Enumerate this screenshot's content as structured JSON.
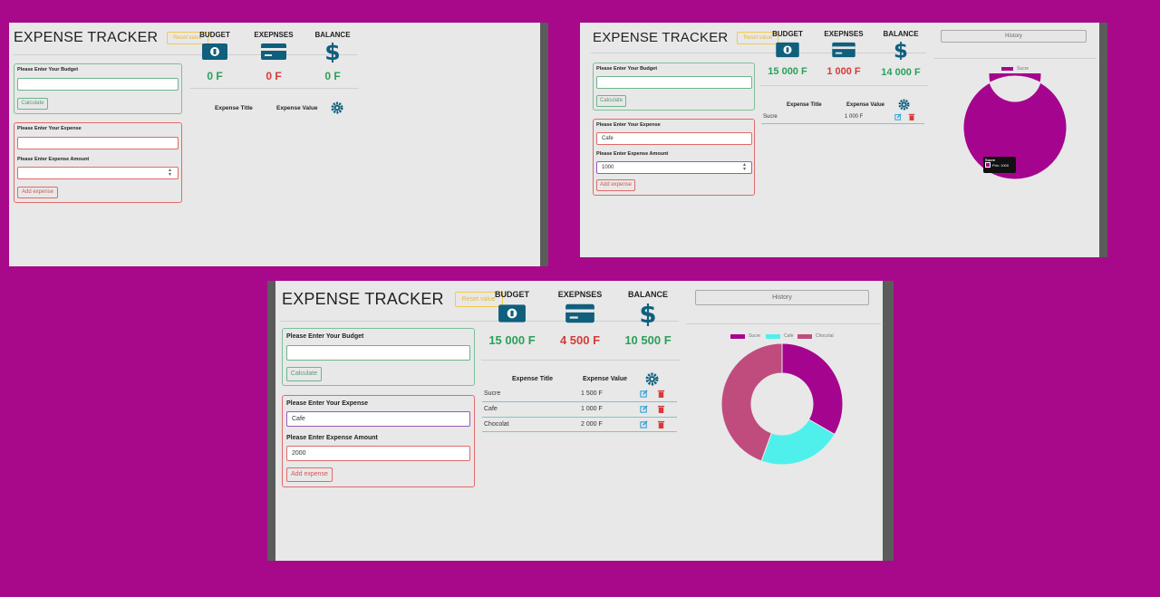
{
  "app": {
    "title": "EXPENSE TRACKER",
    "reset_label": "Reset value",
    "budget_label": "BUDGET",
    "expenses_label": "EXEPNSES",
    "balance_label": "BALANCE",
    "budget_input_label": "Please Enter Your Budget",
    "calculate_label": "Calculate",
    "expense_input_label": "Please Enter Your Expense",
    "amount_input_label": "Please Enter Expense Amount",
    "add_expense_label": "Add expense",
    "col_title": "Expense Title",
    "col_value": "Expense Value",
    "history_label": "History"
  },
  "colors": {
    "page_bg": "#a8098a",
    "panel_bg": "#e8e8e8",
    "icon_blue": "#0f5f7d",
    "green": "#2aa05a",
    "red": "#d63a3a",
    "sucre": "#a5058e",
    "cafe": "#4ff0ec",
    "chocolat": "#c04c7d"
  },
  "icons": [
    "money-bill-icon",
    "credit-card-icon",
    "dollar-icon",
    "gear-icon",
    "edit-icon",
    "trash-icon"
  ],
  "shot1": {
    "budget": "0 F",
    "expenses": "0 F",
    "balance": "0 F",
    "budget_input": "",
    "expense_input": "",
    "amount_input": ""
  },
  "shot2": {
    "budget": "15 000 F",
    "expenses": "1 000 F",
    "balance": "14 000 F",
    "budget_input": "",
    "expense_input": "Cafe",
    "amount_input": "1000",
    "rows": [
      {
        "title": "Sucre",
        "value": "1 000 F"
      }
    ],
    "legend": [
      {
        "name": "Sucre"
      }
    ],
    "tooltip": {
      "title": "Sucre",
      "body": "Prix: 1000"
    },
    "chart_data": {
      "type": "pie",
      "categories": [
        "Sucre"
      ],
      "values": [
        1000
      ]
    }
  },
  "shot3": {
    "budget": "15 000 F",
    "expenses": "4 500 F",
    "balance": "10 500 F",
    "budget_input": "",
    "expense_input": "Cafe",
    "amount_input": "2000",
    "rows": [
      {
        "title": "Sucre",
        "value": "1 500 F"
      },
      {
        "title": "Cafe",
        "value": "1 000 F"
      },
      {
        "title": "Chocolat",
        "value": "2 000 F"
      }
    ],
    "legend": [
      {
        "name": "Sucre"
      },
      {
        "name": "Cafe"
      },
      {
        "name": "Chocolat"
      }
    ],
    "chart_data": {
      "type": "pie",
      "categories": [
        "Sucre",
        "Cafe",
        "Chocolat"
      ],
      "values": [
        1500,
        1000,
        2000
      ]
    }
  }
}
